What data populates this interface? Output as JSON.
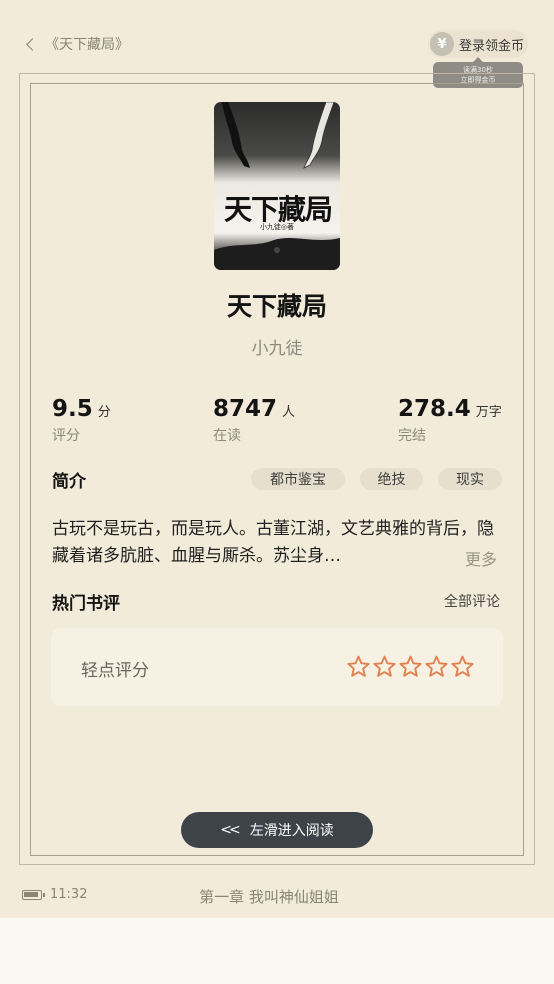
{
  "header": {
    "back_label": "《天下藏局》",
    "login_coin_label": "登录领金币",
    "coin_symbol": "¥",
    "tooltip_line1": "读满30秒",
    "tooltip_line2": "立即得金币"
  },
  "book": {
    "cover_title": "天下藏局",
    "cover_author": "小九徒◎著",
    "title": "天下藏局",
    "author": "小九徒"
  },
  "stats": [
    {
      "value": "9.5",
      "unit": "分",
      "label": "评分"
    },
    {
      "value": "8747",
      "unit": "人",
      "label": "在读"
    },
    {
      "value": "278.4",
      "unit": "万字",
      "label": "完结"
    }
  ],
  "intro": {
    "heading": "简介",
    "tags": [
      "都市鉴宝",
      "绝技",
      "现实"
    ],
    "text": "古玩不是玩古，而是玩人。古董江湖，文艺典雅的背后，隐藏着诸多肮脏、血腥与厮杀。苏尘身…",
    "more_label": "更多"
  },
  "reviews": {
    "heading": "热门书评",
    "all_label": "全部评论",
    "rating_label": "轻点评分",
    "stars_filled": 0,
    "stars_total": 5
  },
  "swipe": {
    "label": "左滑进入阅读",
    "icon": "double-chevron-left-icon"
  },
  "status": {
    "time": "11:32",
    "chapter": "第一章 我叫神仙姐姐"
  },
  "colors": {
    "background": "#f3ebd9",
    "star_outline": "#e0814f",
    "button_dark": "#3e434a"
  }
}
